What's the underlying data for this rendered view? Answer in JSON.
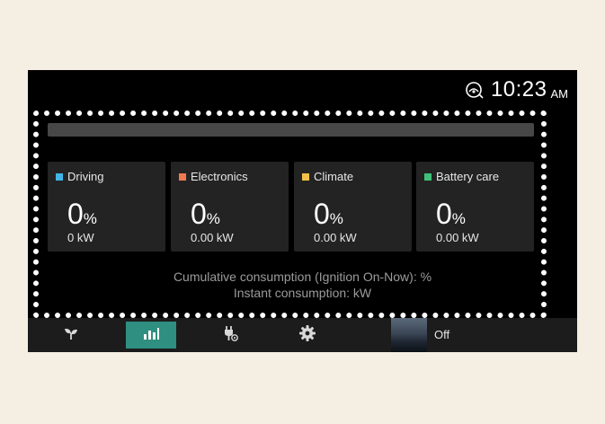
{
  "status": {
    "time": "10:23",
    "ampm": "AM",
    "signal_icon": "network-signal-icon"
  },
  "energy_bar": {
    "level": 0
  },
  "cards": [
    {
      "label": "Driving",
      "color": "#3fb6e6",
      "percent": "0",
      "unit": "%",
      "power": "0 kW"
    },
    {
      "label": "Electronics",
      "color": "#f07a50",
      "percent": "0",
      "unit": "%",
      "power": "0.00 kW"
    },
    {
      "label": "Climate",
      "color": "#f2c048",
      "percent": "0",
      "unit": "%",
      "power": "0.00 kW"
    },
    {
      "label": "Battery care",
      "color": "#3fc07a",
      "percent": "0",
      "unit": "%",
      "power": "0.00 kW"
    }
  ],
  "consumption": {
    "cumulative": "Cumulative consumption (Ignition On-Now): %",
    "instant": "Instant consumption: kW"
  },
  "navbar": {
    "items": [
      "eco-leaf-icon",
      "bar-chart-icon",
      "charging-plug-icon",
      "settings-gear-icon"
    ],
    "active": "bar-chart-icon",
    "media_label": "Off"
  }
}
